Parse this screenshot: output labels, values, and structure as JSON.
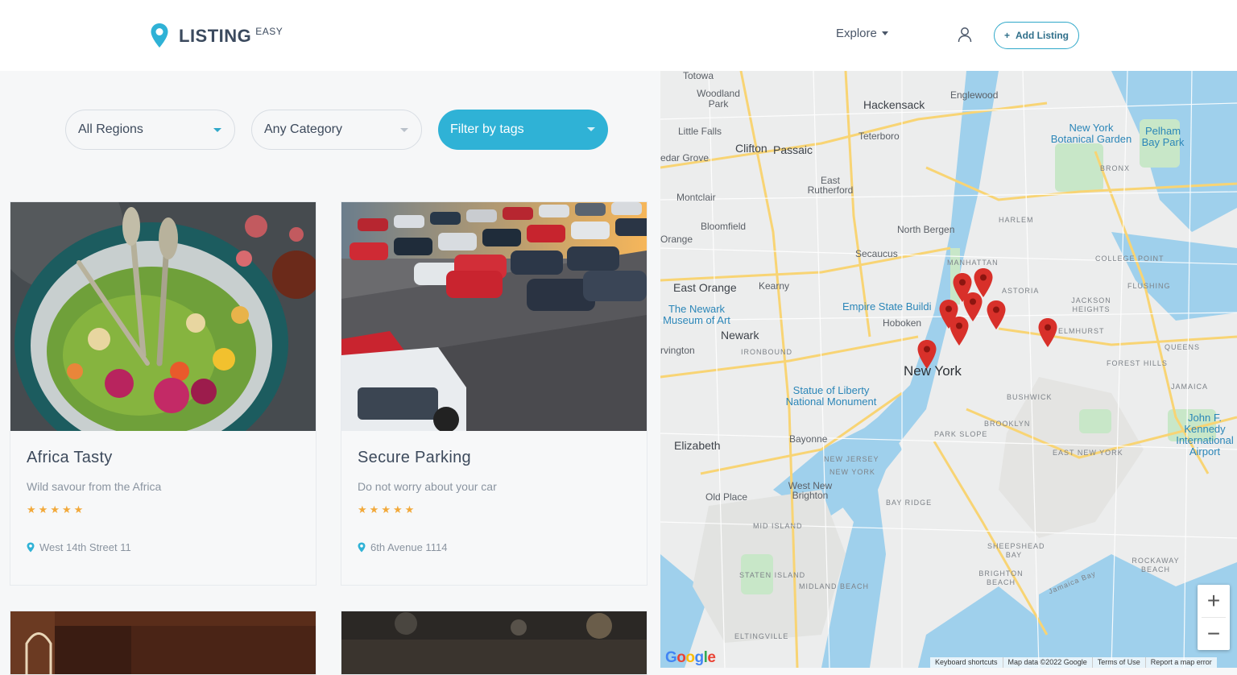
{
  "brand": {
    "name": "LISTING",
    "suffix": "EASY",
    "accent": "#2fb2d6"
  },
  "nav": {
    "explore_label": "Explore",
    "user_icon": "user-icon",
    "add_listing_label": "Add Listing",
    "add_icon": "+"
  },
  "filters": {
    "regions": "All Regions",
    "category": "Any Category",
    "tags": "Filter by tags"
  },
  "listings": [
    {
      "title": "Africa Tasty",
      "description": "Wild savour from the Africa",
      "rating": 5,
      "address": "West 14th Street 11"
    },
    {
      "title": "Secure Parking",
      "description": "Do not worry about your car",
      "rating": 5,
      "address": "6th Avenue 1114"
    }
  ],
  "map": {
    "labels": [
      {
        "text": "Totowa",
        "k": ""
      },
      {
        "text": "Woodland Park",
        "k": ""
      },
      {
        "text": "Hackensack",
        "k": "mid"
      },
      {
        "text": "Englewood",
        "k": ""
      },
      {
        "text": "Little Falls",
        "k": ""
      },
      {
        "text": "Teterboro",
        "k": ""
      },
      {
        "text": "New York Botanical Garden",
        "k": "poi"
      },
      {
        "text": "Pelham Bay Park",
        "k": "poi"
      },
      {
        "text": "Clifton",
        "k": "mid"
      },
      {
        "text": "Passaic",
        "k": "mid"
      },
      {
        "text": "edar Grove",
        "k": ""
      },
      {
        "text": "BRONX",
        "k": "sm"
      },
      {
        "text": "East Rutherford",
        "k": ""
      },
      {
        "text": "Montclair",
        "k": ""
      },
      {
        "text": "HARLEM",
        "k": "sm"
      },
      {
        "text": "Bloomfield",
        "k": ""
      },
      {
        "text": "North Bergen",
        "k": ""
      },
      {
        "text": "Orange",
        "k": ""
      },
      {
        "text": "Secaucus",
        "k": ""
      },
      {
        "text": "COLLEGE POINT",
        "k": "sm"
      },
      {
        "text": "MANHATTAN",
        "k": "sm"
      },
      {
        "text": "FLUSHING",
        "k": "sm"
      },
      {
        "text": "East Orange",
        "k": "mid"
      },
      {
        "text": "Kearny",
        "k": ""
      },
      {
        "text": "ASTORIA",
        "k": "sm"
      },
      {
        "text": "The Newark Museum of Art",
        "k": "poi"
      },
      {
        "text": "Empire State Buildi",
        "k": "poi"
      },
      {
        "text": "JACKSON HEIGHTS",
        "k": "sm"
      },
      {
        "text": "Newark",
        "k": "mid"
      },
      {
        "text": "Hoboken",
        "k": ""
      },
      {
        "text": "ELMHURST",
        "k": "sm"
      },
      {
        "text": "rvington",
        "k": ""
      },
      {
        "text": "IRONBOUND",
        "k": "sm"
      },
      {
        "text": "QUEENS",
        "k": "sm"
      },
      {
        "text": "FOREST HILLS",
        "k": "sm"
      },
      {
        "text": "New York",
        "k": "big"
      },
      {
        "text": "JAMAICA",
        "k": "sm"
      },
      {
        "text": "Statue of Liberty National Monument",
        "k": "poi"
      },
      {
        "text": "BUSHWICK",
        "k": "sm"
      },
      {
        "text": "BROOKLYN",
        "k": "sm"
      },
      {
        "text": "Elizabeth",
        "k": "mid"
      },
      {
        "text": "Bayonne",
        "k": ""
      },
      {
        "text": "PARK SLOPE",
        "k": "sm"
      },
      {
        "text": "John F. Kennedy International Airport",
        "k": "poi"
      },
      {
        "text": "EAST NEW YORK",
        "k": "sm"
      },
      {
        "text": "NEW JERSEY",
        "k": "sm"
      },
      {
        "text": "NEW YORK",
        "k": "sm"
      },
      {
        "text": "West New Brighton",
        "k": ""
      },
      {
        "text": "Old Place",
        "k": ""
      },
      {
        "text": "BAY RIDGE",
        "k": "sm"
      },
      {
        "text": "MID ISLAND",
        "k": "sm"
      },
      {
        "text": "SHEEPSHEAD BAY",
        "k": "sm"
      },
      {
        "text": "ROCKAWAY BEACH",
        "k": "sm"
      },
      {
        "text": "STATEN ISLAND",
        "k": "sm"
      },
      {
        "text": "MIDLAND BEACH",
        "k": "sm"
      },
      {
        "text": "BRIGHTON BEACH",
        "k": "sm"
      },
      {
        "text": "Jamaica Bay",
        "k": "sm"
      },
      {
        "text": "ELTINGVILLE",
        "k": "sm"
      }
    ],
    "footer": {
      "keyboard": "Keyboard shortcuts",
      "data": "Map data ©2022 Google",
      "terms": "Terms of Use",
      "report": "Report a map error"
    },
    "zoom_in": "+",
    "zoom_out": "−",
    "google_logo": "Google",
    "marker_color": "#d8302a"
  }
}
